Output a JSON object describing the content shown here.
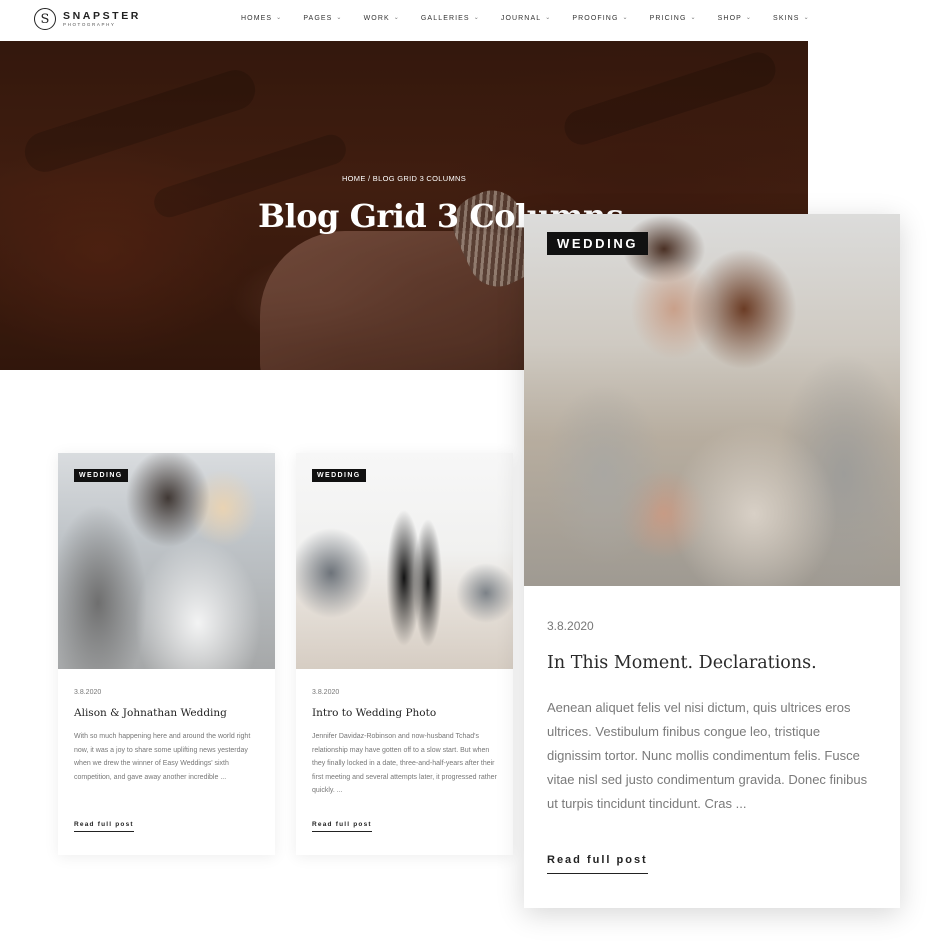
{
  "brand": {
    "name": "SNAPSTER",
    "tagline": "PHOTOGRAPHY",
    "mark": "S"
  },
  "nav": {
    "items": [
      {
        "label": "HOMES"
      },
      {
        "label": "PAGES"
      },
      {
        "label": "WORK"
      },
      {
        "label": "GALLERIES"
      },
      {
        "label": "JOURNAL"
      },
      {
        "label": "PROOFING"
      },
      {
        "label": "PRICING"
      },
      {
        "label": "SHOP"
      },
      {
        "label": "SKINS"
      }
    ],
    "chevron": "⌄"
  },
  "hero": {
    "breadcrumb": "HOME / BLOG GRID 3 COLUMNS",
    "title": "Blog Grid 3 Columns"
  },
  "posts": [
    {
      "category": "WEDDING",
      "date": "3.8.2020",
      "title": "Alison & Johnathan Wedding",
      "excerpt": "With so much happening here and around the world right now, it was a joy to share some uplifting news yesterday when we drew the winner of Easy Weddings' sixth competition, and gave away another incredible ...",
      "read_more": "Read full post"
    },
    {
      "category": "WEDDING",
      "date": "3.8.2020",
      "title": "Intro to Wedding Photo",
      "excerpt": "Jennifer Davidaz-Robinson and now-husband Tchad's relationship may have gotten off to a slow start. But when they finally locked in a date, three-and-half-years after their first meeting and several attempts later, it progressed rather quickly. ...",
      "read_more": "Read full post"
    }
  ],
  "featured": {
    "category": "WEDDING",
    "date": "3.8.2020",
    "title": "In This Moment. Declarations.",
    "excerpt": "Aenean aliquet felis vel nisi dictum, quis ultrices eros ultrices. Vestibulum finibus congue leo, tristique dignissim tortor. Nunc mollis condimentum felis. Fusce vitae nisl sed justo condimentum gravida. Donec finibus ut turpis tincidunt tincidunt. Cras ...",
    "read_more": "Read full post"
  },
  "colors": {
    "badge": "#111111",
    "text": "#222222",
    "muted": "#777777",
    "hero": "#4a2214"
  }
}
